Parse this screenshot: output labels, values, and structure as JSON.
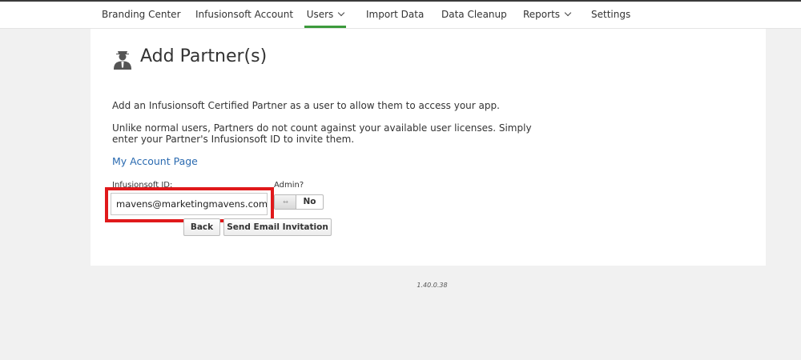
{
  "nav": {
    "items": [
      {
        "label": "Branding Center"
      },
      {
        "label": "Infusionsoft Account"
      },
      {
        "label": "Users",
        "active": true,
        "dropdown": true
      },
      {
        "label": "Import Data"
      },
      {
        "label": "Data Cleanup"
      },
      {
        "label": "Reports",
        "dropdown": true
      },
      {
        "label": "Settings"
      }
    ]
  },
  "page": {
    "title": "Add Partner(s)",
    "title_icon": "partner-user-icon",
    "intro": "Add an Infusionsoft Certified Partner as a user to allow them to access your app.",
    "note_line1": "Unlike normal users, Partners do not count against your available user licenses. Simply",
    "note_line2": "enter your Partner's Infusionsoft ID to invite them.",
    "account_link": "My Account Page"
  },
  "form": {
    "id_label": "Infusionsoft ID:",
    "id_value": "mavens@marketingmavens.com",
    "admin_label": "Admin?",
    "admin_toggle_knob": "↔",
    "admin_toggle_value": "No",
    "back_label": "Back",
    "send_label": "Send Email Invitation"
  },
  "colors": {
    "highlight": "#e0191b",
    "link": "#2a6ab0",
    "active_tab": "#3c9a3c"
  },
  "footer": {
    "version": "1.40.0.38"
  }
}
